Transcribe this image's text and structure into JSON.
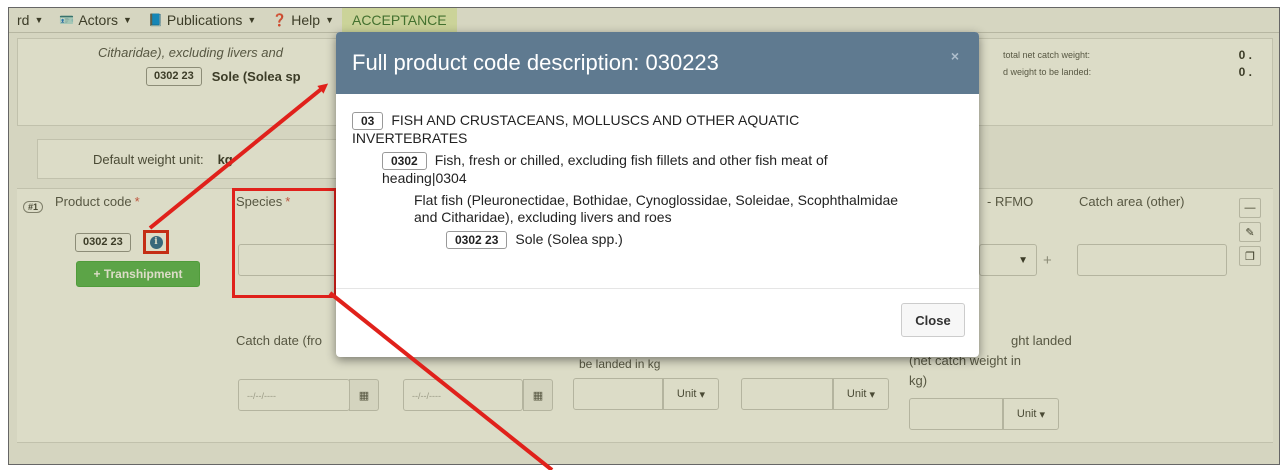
{
  "navbar": {
    "items": [
      {
        "label": "rd",
        "icon": ""
      },
      {
        "label": "Actors",
        "icon": "id-card-icon"
      },
      {
        "label": "Publications",
        "icon": "book-icon"
      },
      {
        "label": "Help",
        "icon": "question-circle-icon"
      }
    ],
    "environment": "ACCEPTANCE"
  },
  "summary": {
    "line1": "Citharidae), excluding livers and",
    "code": "0302 23",
    "species": "Sole (Solea sp",
    "right_label_1": "total net catch weight:",
    "right_label_2": "d weight to be landed:",
    "right_value_1": "0 .",
    "right_value_2": "0 ."
  },
  "weight_unit": {
    "label": "Default weight unit:",
    "value": "kg"
  },
  "catch_row": {
    "number": "#1",
    "product_code_label": "Product code",
    "product_code_value": "0302 23",
    "transhipment_button": "+ Transhipment",
    "species_label": "Species",
    "rfmo_label": "- RFMO",
    "catch_area_other_label": "Catch area (other)",
    "catch_date_label": "Catch date (fro",
    "landed_label_fragment": "be landed in kg",
    "weight_landed_label_1": "ght landed",
    "weight_landed_label_2": "(net catch weight in",
    "weight_landed_label_3": "kg)",
    "date_placeholder": "--/--/----",
    "unit_label": "Unit",
    "plus": "+"
  },
  "modal": {
    "title": "Full product code description: 030223",
    "close_x": "×",
    "levels": [
      {
        "code": "03",
        "text": "FISH AND CRUSTACEANS, MOLLUSCS AND OTHER AQUATIC",
        "text2": "INVERTEBRATES"
      },
      {
        "code": "0302",
        "text": "Fish, fresh or chilled, excluding fish fillets and other fish meat of",
        "text2": "heading|0304"
      },
      {
        "code": "",
        "text": "Flat fish (Pleuronectidae, Bothidae, Cynoglossidae, Soleidae, Scophthalmidae",
        "text2": "and Citharidae), excluding livers and roes"
      },
      {
        "code": "0302 23",
        "text": "Sole (Solea spp.)",
        "text2": ""
      }
    ],
    "close_button": "Close"
  },
  "colors": {
    "modal_header": "#5f7a90",
    "annotation_red": "#e0211b",
    "transhipment_green": "#5cb85c",
    "info_blue": "#2e6b9e"
  }
}
